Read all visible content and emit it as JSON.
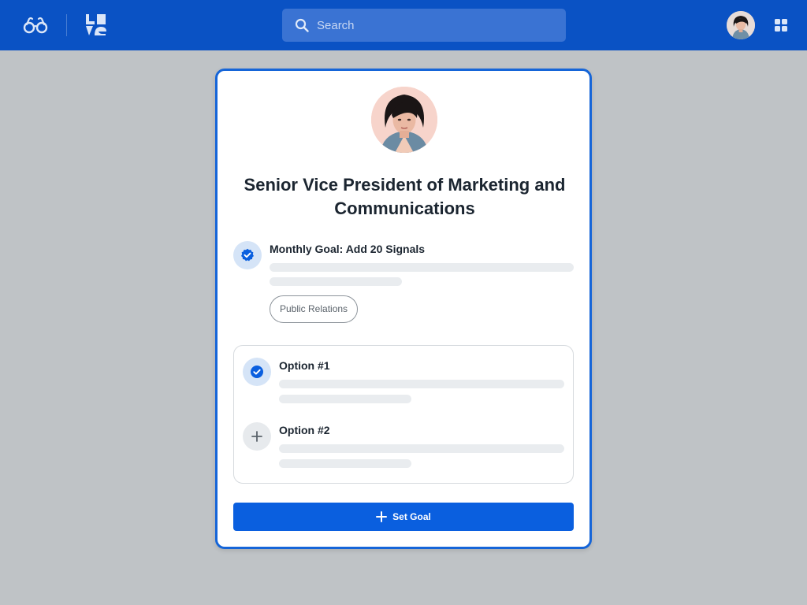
{
  "topbar": {
    "search": {
      "placeholder": "Search"
    }
  },
  "card": {
    "title": "Senior Vice President of Marketing and Communications",
    "goal": {
      "title": "Monthly Goal: Add 20 Signals",
      "tag": "Public Relations"
    },
    "options": [
      {
        "title": "Option #1",
        "selected": true
      },
      {
        "title": "Option #2",
        "selected": false
      }
    ],
    "set_goal_label": "Set Goal"
  },
  "colors": {
    "topbar": "#0a52c4",
    "accent": "#0a5fdf",
    "card_border": "#1565d8",
    "background": "#bfc3c6"
  },
  "icons": {
    "brand": "glasses-icon",
    "product": "logo-mark-icon",
    "search": "search-icon",
    "apps": "apps-grid-icon",
    "selected": "check-badge-icon",
    "add": "plus-icon"
  }
}
